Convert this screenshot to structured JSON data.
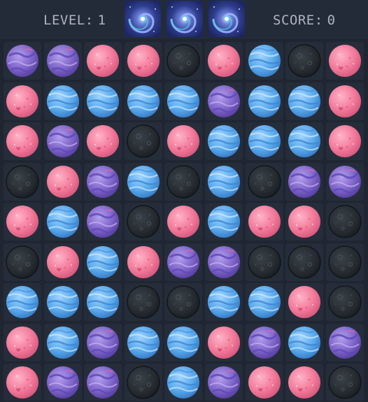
{
  "hud": {
    "level_label": "LEVEL:",
    "level_value": "1",
    "score_label": "SCORE:",
    "score_value": "0",
    "lives": 3,
    "life_icon": "galaxy-swirl-icon"
  },
  "colors": {
    "pink": "#f27a9a",
    "blue": "#58a8ec",
    "purple": "#7e63c8",
    "black": "#23292f",
    "background": "#1f2632",
    "cell": "#252d3a",
    "hud_text": "#aeb4bf"
  },
  "board": {
    "rows": 9,
    "cols": 9,
    "grid": [
      [
        "purple",
        "purple",
        "pink",
        "pink",
        "black",
        "pink",
        "blue",
        "black",
        "pink"
      ],
      [
        "pink",
        "blue",
        "blue",
        "blue",
        "blue",
        "purple",
        "blue",
        "blue",
        "pink"
      ],
      [
        "pink",
        "purple",
        "pink",
        "black",
        "pink",
        "blue",
        "blue",
        "blue",
        "pink"
      ],
      [
        "black",
        "pink",
        "purple",
        "blue",
        "black",
        "blue",
        "black",
        "purple",
        "purple"
      ],
      [
        "pink",
        "blue",
        "purple",
        "black",
        "pink",
        "blue",
        "pink",
        "pink",
        "black"
      ],
      [
        "black",
        "pink",
        "blue",
        "pink",
        "purple",
        "purple",
        "black",
        "black",
        "black"
      ],
      [
        "blue",
        "blue",
        "blue",
        "black",
        "black",
        "blue",
        "blue",
        "pink",
        "black"
      ],
      [
        "pink",
        "blue",
        "purple",
        "blue",
        "blue",
        "pink",
        "purple",
        "blue",
        "purple"
      ],
      [
        "pink",
        "purple",
        "purple",
        "black",
        "blue",
        "purple",
        "pink",
        "pink",
        "black"
      ]
    ]
  }
}
